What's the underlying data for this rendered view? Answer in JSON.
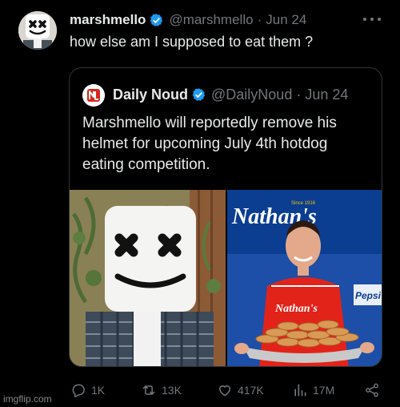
{
  "tweet": {
    "name": "marshmello",
    "handle": "@marshmello",
    "separator": "·",
    "date": "Jun 24",
    "text": "how else am I supposed to eat them ?"
  },
  "quoted": {
    "name": "Daily Noud",
    "handle": "@DailyNoud",
    "separator": "·",
    "date": "Jun 24",
    "text": "Marshmello will reportedly remove his helmet for upcoming July 4th hotdog eating competition."
  },
  "media": {
    "right_brand_text": "Nathan's",
    "right_since_text": "Since 1916",
    "shirt_text": "Nathan's",
    "side_sign_text": "Pepsi"
  },
  "actions": {
    "replies": "1K",
    "reposts": "13K",
    "likes": "417K",
    "views": "17M"
  },
  "icons": {
    "verified": "verified-badge-icon",
    "more": "more-dots-icon",
    "reply": "reply-icon",
    "repost": "repost-icon",
    "like": "heart-icon",
    "views": "views-icon",
    "share": "share-icon"
  },
  "colors": {
    "background": "#000000",
    "text": "#e7e9ea",
    "muted": "#71767b",
    "verified": "#1d9bf0",
    "border": "#2f3336"
  },
  "watermark": "imgflip.com"
}
